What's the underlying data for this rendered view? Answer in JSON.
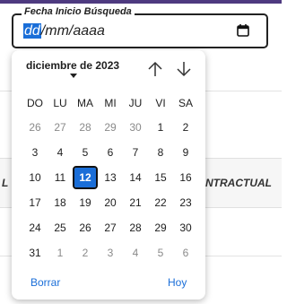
{
  "field": {
    "legend": "Fecha Inicio Búsqueda",
    "value_dd": "dd",
    "value_rest": "/mm/aaaa",
    "calendar_button_icon": "calendar-icon"
  },
  "background": {
    "column_left": "L",
    "column_right": "NTRACTUAL"
  },
  "calendar": {
    "month_label": "diciembre de 2023",
    "nav_prev_icon": "arrow-up-icon",
    "nav_next_icon": "arrow-down-icon",
    "weekdays": [
      "DO",
      "LU",
      "MA",
      "MI",
      "JU",
      "VI",
      "SA"
    ],
    "weeks": [
      [
        "26",
        "27",
        "28",
        "29",
        "30",
        "1",
        "2"
      ],
      [
        "3",
        "4",
        "5",
        "6",
        "7",
        "8",
        "9"
      ],
      [
        "10",
        "11",
        "12",
        "13",
        "14",
        "15",
        "16"
      ],
      [
        "17",
        "18",
        "19",
        "20",
        "21",
        "22",
        "23"
      ],
      [
        "24",
        "25",
        "26",
        "27",
        "28",
        "29",
        "30"
      ],
      [
        "31",
        "1",
        "2",
        "3",
        "4",
        "5",
        "6"
      ]
    ],
    "muted_cells": [
      [
        0,
        0
      ],
      [
        0,
        1
      ],
      [
        0,
        2
      ],
      [
        0,
        3
      ],
      [
        0,
        4
      ],
      [
        5,
        1
      ],
      [
        5,
        2
      ],
      [
        5,
        3
      ],
      [
        5,
        4
      ],
      [
        5,
        5
      ],
      [
        5,
        6
      ]
    ],
    "selected_cell": [
      2,
      2
    ],
    "clear_label": "Borrar",
    "today_label": "Hoy"
  },
  "colors": {
    "accent": "#1a6ed8",
    "top_bar": "#4e3a80"
  }
}
